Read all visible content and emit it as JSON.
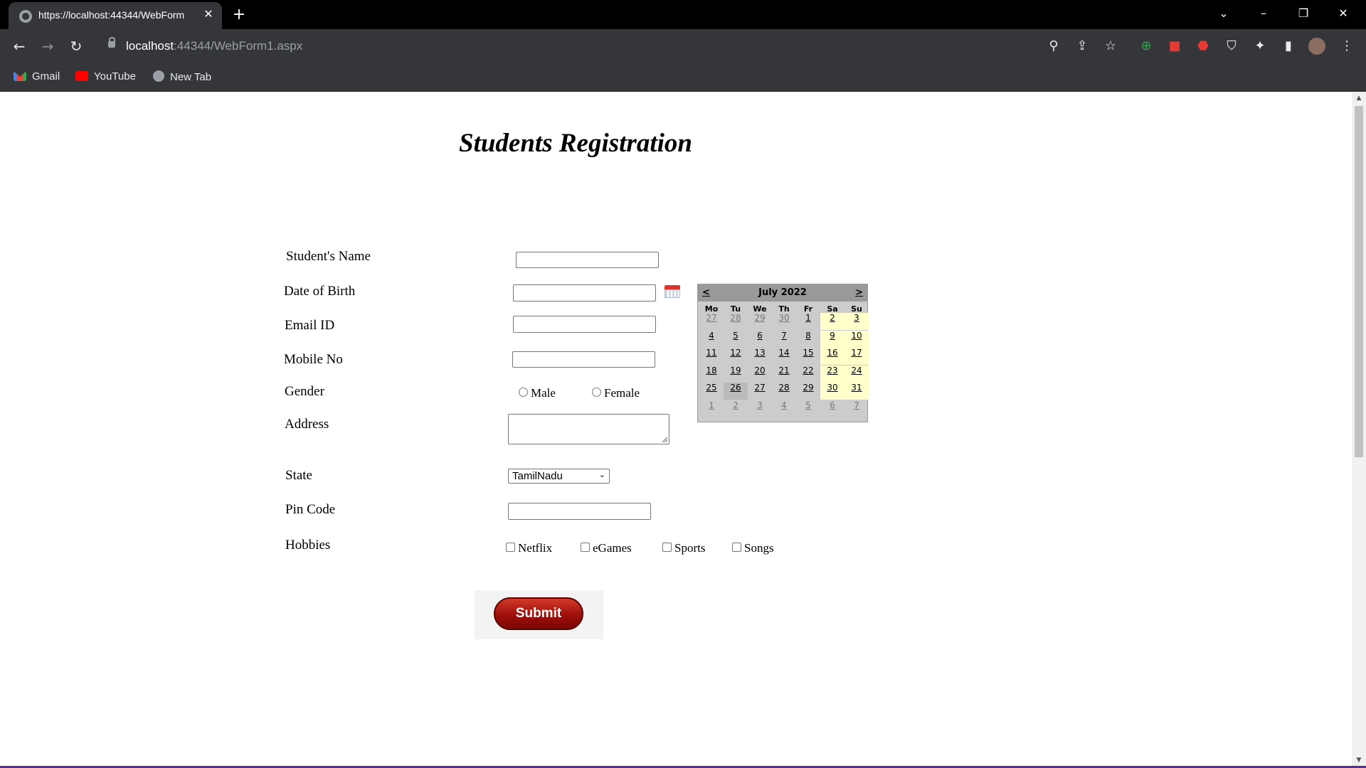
{
  "browser": {
    "tab_title": "https://localhost:44344/WebForm",
    "url_host": "localhost",
    "url_rest": ":44344/WebForm1.aspx",
    "bookmarks": [
      "Gmail",
      "YouTube",
      "New Tab"
    ]
  },
  "form": {
    "title": "Students Registration",
    "labels": {
      "name": "Student's Name",
      "dob": "Date of Birth",
      "email": "Email ID",
      "mobile": "Mobile No",
      "gender": "Gender",
      "address": "Address",
      "state": "State",
      "pincode": "Pin Code",
      "hobbies": "Hobbies"
    },
    "values": {
      "name": "",
      "dob": "",
      "email": "",
      "mobile": "",
      "address": "",
      "pincode": ""
    },
    "gender_options": [
      "Male",
      "Female"
    ],
    "state_selected": "TamilNadu",
    "hobbies": [
      "Netflix",
      "eGames",
      "Sports",
      "Songs"
    ],
    "submit_label": "Submit"
  },
  "calendar": {
    "title": "July 2022",
    "prev": "<",
    "next": ">",
    "days_of_week": [
      "Mo",
      "Tu",
      "We",
      "Th",
      "Fr",
      "Sa",
      "Su"
    ],
    "weeks": [
      [
        "27",
        "28",
        "29",
        "30",
        "1",
        "2",
        "3"
      ],
      [
        "4",
        "5",
        "6",
        "7",
        "8",
        "9",
        "10"
      ],
      [
        "11",
        "12",
        "13",
        "14",
        "15",
        "16",
        "17"
      ],
      [
        "18",
        "19",
        "20",
        "21",
        "22",
        "23",
        "24"
      ],
      [
        "25",
        "26",
        "27",
        "28",
        "29",
        "30",
        "31"
      ],
      [
        "1",
        "2",
        "3",
        "4",
        "5",
        "6",
        "7"
      ]
    ],
    "selected_day": "26"
  }
}
